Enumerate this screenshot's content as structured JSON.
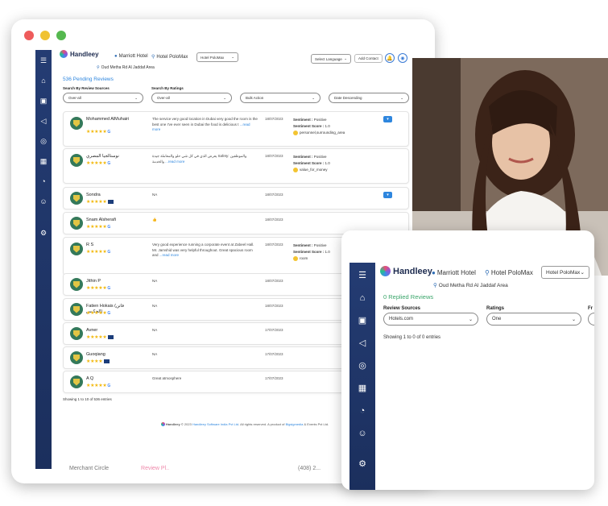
{
  "brand": {
    "name": "Handleey"
  },
  "header": {
    "hotel_chain": "Marriott Hotel",
    "hotel_location": "Hotel PoloMax",
    "hotel_select": "Hotel PoloMax",
    "address": "Oud Metha Rd Al Jaddaf Area",
    "language_select": "Select Language",
    "add_contact": "Add Contact"
  },
  "pending": {
    "title": "536 Pending Reviews"
  },
  "filters": {
    "review_sources_label": "Search By Review Sources",
    "review_sources_value": "Over-all",
    "ratings_label": "Search By Ratings",
    "ratings_value": "Over-all",
    "bulk_action": "Bulk Action",
    "sort": "Date Descending"
  },
  "reviews": [
    {
      "name": "Mohammed AlMuhairi",
      "stars": "★★★★★",
      "source": "G",
      "text": "The service very good location in Dubai very good the room is the best one I've ever seen in Dubai the food is delicious t",
      "more": "...read more",
      "date": "18/07/2023",
      "sentiment": "Positive",
      "score": "1.0",
      "topic": "personnel,surrounding_area"
    },
    {
      "name": "نوستالجيا المصري",
      "stars": "★★★★★",
      "source": "G",
      "text": "يعرض الذي في كل شي حلو والمعاملة جيدة Safety: والموظفين والخدمة",
      "more": "...read more",
      "date": "18/07/2023",
      "sentiment": "Positive",
      "score": "1.0",
      "topic": "value_for_money"
    },
    {
      "name": "Sondra",
      "stars": "★★★★★",
      "source": "box",
      "text": "NA",
      "more": "",
      "date": "18/07/2023",
      "sentiment": "",
      "score": "",
      "topic": ""
    },
    {
      "name": "Snam Alsherafi",
      "stars": "★★★★★",
      "source": "G",
      "text": "👍",
      "more": "",
      "date": "18/07/2023",
      "sentiment": "",
      "score": "",
      "topic": ""
    },
    {
      "name": "R S",
      "stars": "★★★★★",
      "source": "G",
      "text": "Very good experience running a corporate event at Zabeel Hall. Mr. Jamshid was very helpful throughout. Great spacious room and",
      "more": "...read more",
      "date": "18/07/2023",
      "sentiment": "Positive",
      "score": "1.0",
      "topic": "room"
    },
    {
      "name": "Jithin P",
      "stars": "★★★★★",
      "source": "G",
      "text": "NA",
      "more": "",
      "date": "18/07/2023",
      "sentiment": "",
      "score": "",
      "topic": ""
    },
    {
      "name": "Fatien Hokais (فاتن الحكيس)",
      "stars": "★★★★★",
      "source": "G",
      "text": "NA",
      "more": "",
      "date": "18/07/2023",
      "sentiment": "",
      "score": "",
      "topic": ""
    },
    {
      "name": "Avner",
      "stars": "★★★★★",
      "source": "box",
      "text": "NA",
      "more": "",
      "date": "17/07/2023",
      "sentiment": "",
      "score": "",
      "topic": ""
    },
    {
      "name": "Guoqiang",
      "stars": "★★★★",
      "source": "box",
      "text": "NA",
      "more": "",
      "date": "17/07/2023",
      "sentiment": "",
      "score": "",
      "topic": ""
    },
    {
      "name": "A Q",
      "stars": "★★★★★",
      "source": "G",
      "text": "Great atmosphere",
      "more": "",
      "date": "17/07/2023",
      "sentiment": "",
      "score": "",
      "topic": ""
    }
  ],
  "labels": {
    "sentiment": "Sentiment :",
    "score": "Sentiment Score :"
  },
  "showing": "Showing 1 to 10 of 536 entries",
  "footer": {
    "brand": "Handleey",
    "text1": "© 2023",
    "company": "Handleey Software India Pvt Ltd",
    "text2": ". All rights reserved. A product of",
    "partner": "Bigsigmedia",
    "text3": "& Events Pvt Ltd."
  },
  "bottom_strip": {
    "a": "Merchant Circle",
    "b": "Review Pl..",
    "c": "(408) 2..."
  },
  "replied": {
    "title": "0 Replied Reviews",
    "review_sources_label": "Review Sources",
    "review_sources_value": "Hotels.com",
    "ratings_label": "Ratings",
    "ratings_value": "One",
    "extra_label": "Fr",
    "showing": "Showing 1 to 0 of 0 entries"
  },
  "icons": [
    "menu-icon",
    "home-icon",
    "reviews-icon",
    "megaphone-icon",
    "qr-icon",
    "analytics-icon",
    "users-icon",
    "settings-icon"
  ]
}
